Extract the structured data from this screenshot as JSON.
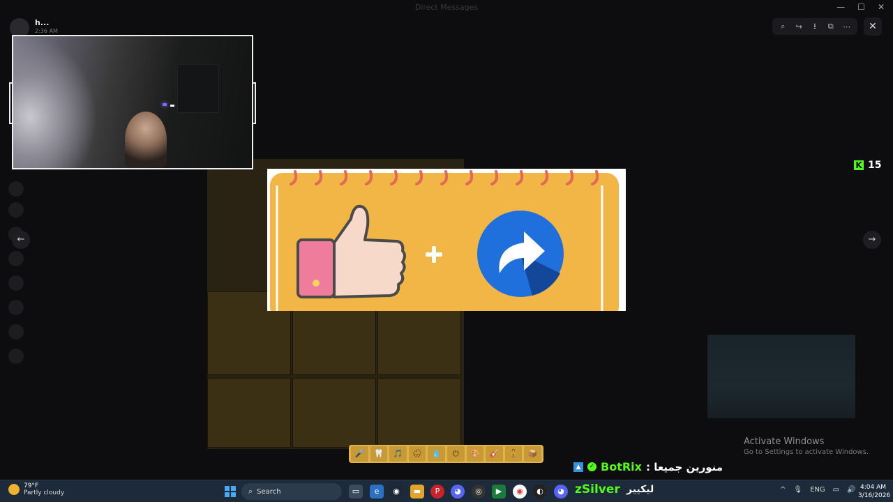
{
  "window": {
    "title": "Direct Messages",
    "controls": [
      "—",
      "☐",
      "✕"
    ]
  },
  "channel": {
    "name": "h...",
    "subtitle": "2:36 AM"
  },
  "viewer": {
    "tools": [
      "zoom-icon",
      "share-icon",
      "download-icon",
      "open-external-icon",
      "more-icon"
    ],
    "close": "✕",
    "prev": "←",
    "next": "→"
  },
  "kick": {
    "count": "15"
  },
  "stickers": [
    "🎤",
    "🦷",
    "🎵",
    "🌧",
    "💧",
    "⏻",
    "🎨",
    "🎸",
    "🧍",
    "📦",
    "📔",
    "🔄"
  ],
  "chat": {
    "botrix_name": "BotRix",
    "botrix_message": ": منورين جميعا",
    "user_name": "zSilver",
    "user_message": "ليكيير"
  },
  "activate": {
    "title": "Activate Windows",
    "subtitle": "Go to Settings to activate Windows."
  },
  "taskbar": {
    "weather_temp": "79°F",
    "weather_desc": "Partly cloudy",
    "search_label": "Search",
    "lang": "ENG",
    "time": "4:04 AM",
    "date": "3/16/2026"
  },
  "colors": {
    "kick_green": "#53fc18",
    "taskbar": "#1c2a3a",
    "image_orange": "#f1b646",
    "share_blue": "#1f6fdc"
  }
}
